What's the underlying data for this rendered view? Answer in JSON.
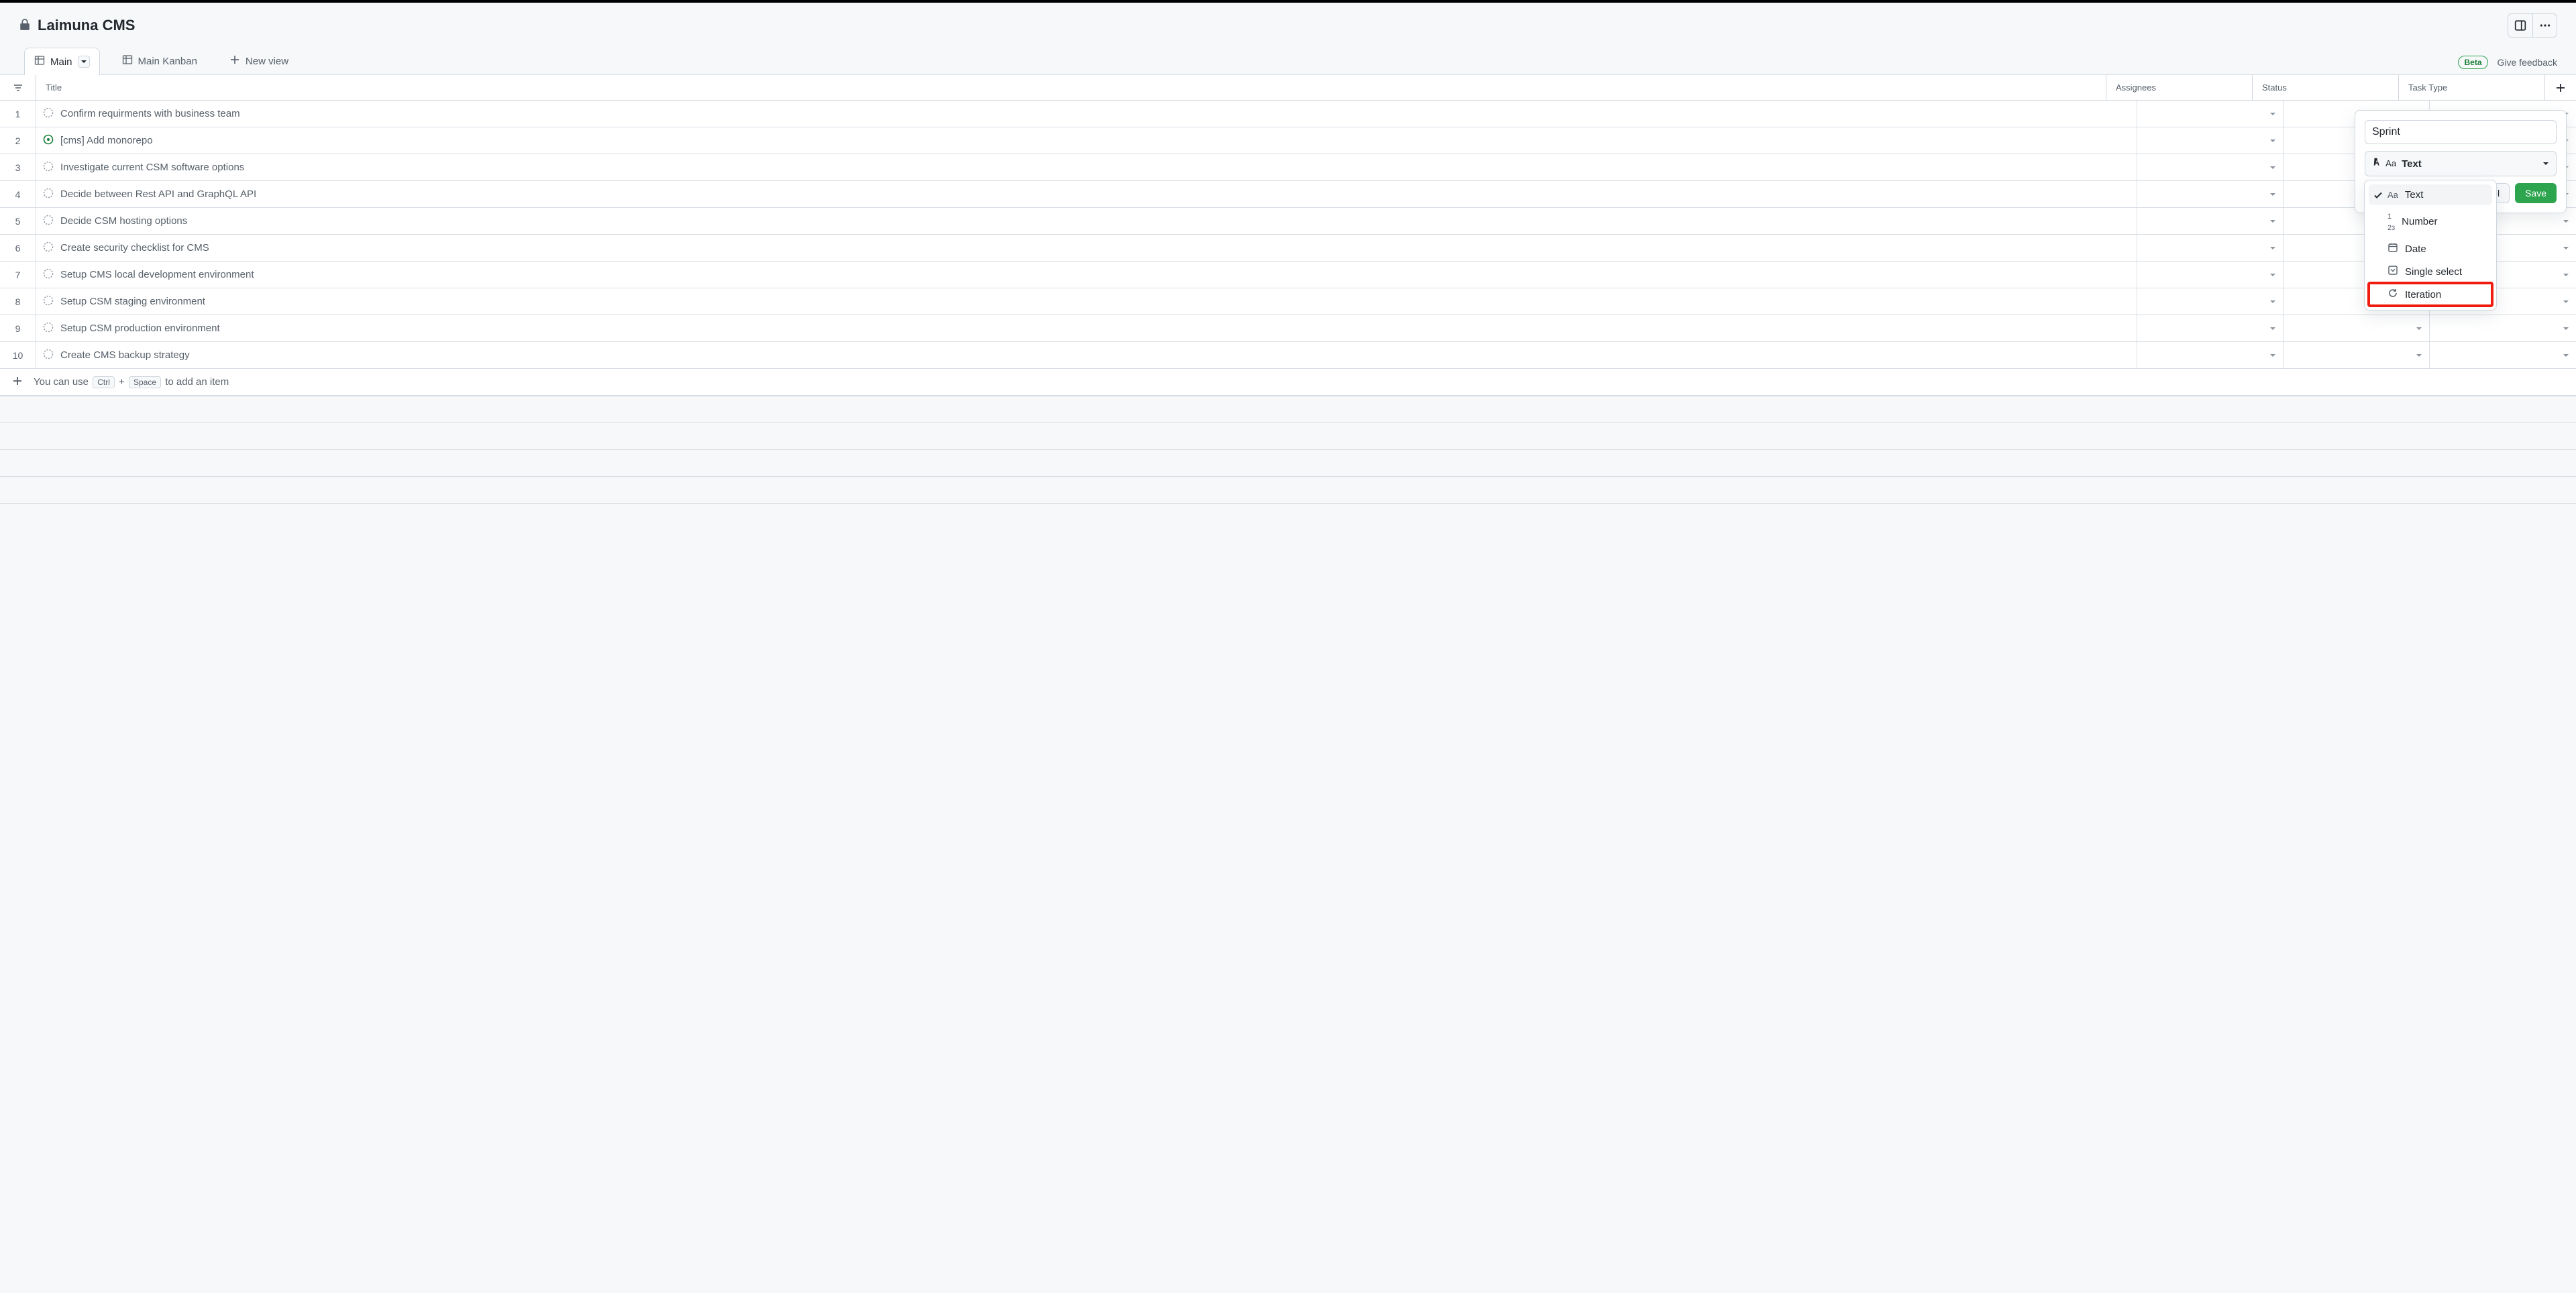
{
  "header": {
    "title": "Laimuna CMS"
  },
  "tabs": {
    "views": [
      {
        "label": "Main",
        "active": true
      },
      {
        "label": "Main Kanban",
        "active": false
      }
    ],
    "new_view_label": "New view",
    "beta_label": "Beta",
    "feedback_label": "Give feedback"
  },
  "columns": {
    "title": "Title",
    "assignees": "Assignees",
    "status": "Status",
    "task_type": "Task Type"
  },
  "rows": [
    {
      "n": "1",
      "icon": "draft",
      "title": "Confirm requirments with business team"
    },
    {
      "n": "2",
      "icon": "open",
      "title": "[cms] Add monorepo"
    },
    {
      "n": "3",
      "icon": "draft",
      "title": "Investigate current CSM software options"
    },
    {
      "n": "4",
      "icon": "draft",
      "title": "Decide between Rest API and GraphQL API"
    },
    {
      "n": "5",
      "icon": "draft",
      "title": "Decide CSM hosting options"
    },
    {
      "n": "6",
      "icon": "draft",
      "title": "Create security checklist for CMS"
    },
    {
      "n": "7",
      "icon": "draft",
      "title": "Setup CMS local development environment"
    },
    {
      "n": "8",
      "icon": "draft",
      "title": "Setup CSM staging environment"
    },
    {
      "n": "9",
      "icon": "draft",
      "title": "Setup CSM production environment"
    },
    {
      "n": "10",
      "icon": "draft",
      "title": "Create CMS backup strategy"
    }
  ],
  "add_row": {
    "pre_text": "You can use",
    "key1": "Ctrl",
    "plus": "+",
    "key2": "Space",
    "post_text": "to add an item"
  },
  "popover": {
    "field_name_value": "Sprint",
    "selected_type_label": "Text",
    "cancel_label": "Cancel",
    "save_label": "Save"
  },
  "type_options": [
    {
      "key": "text",
      "label": "Text",
      "selected": true,
      "highlighted": false
    },
    {
      "key": "number",
      "label": "Number",
      "selected": false,
      "highlighted": false
    },
    {
      "key": "date",
      "label": "Date",
      "selected": false,
      "highlighted": false
    },
    {
      "key": "single_select",
      "label": "Single select",
      "selected": false,
      "highlighted": false
    },
    {
      "key": "iteration",
      "label": "Iteration",
      "selected": false,
      "highlighted": true
    }
  ]
}
